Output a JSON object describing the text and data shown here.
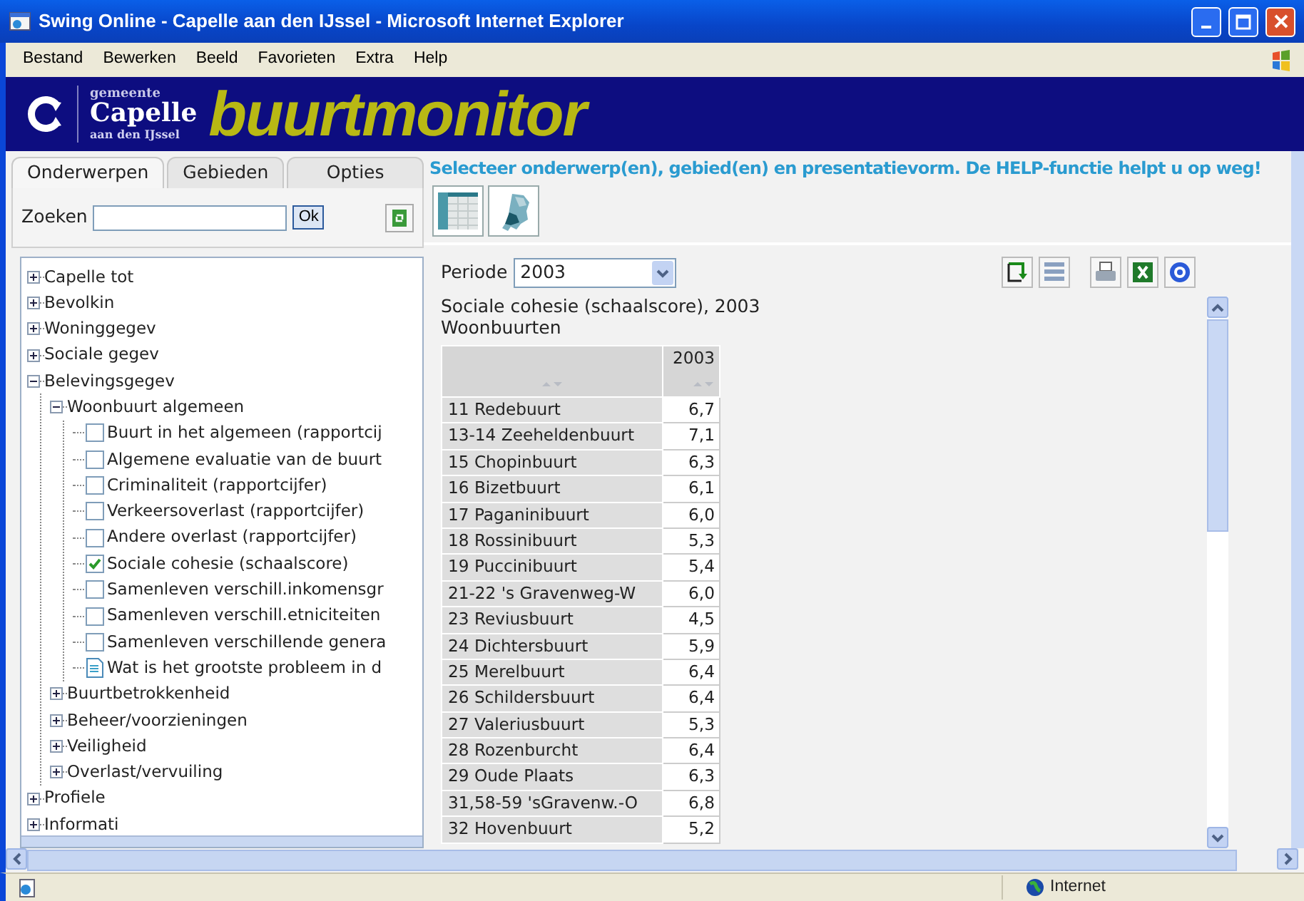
{
  "window": {
    "title": "Swing Online - Capelle aan den IJssel - Microsoft Internet Explorer"
  },
  "menu": [
    "Bestand",
    "Bewerken",
    "Beeld",
    "Favorieten",
    "Extra",
    "Help"
  ],
  "logo": {
    "top": "gemeente",
    "name": "Capelle",
    "sub": "aan den IJssel",
    "product": "buurtmonitor"
  },
  "tabs": [
    {
      "label": "Onderwerpen",
      "selected": true
    },
    {
      "label": "Gebieden",
      "selected": false
    },
    {
      "label": "Opties",
      "selected": false
    }
  ],
  "search": {
    "label": "Zoeken",
    "button": "Ok"
  },
  "tree": [
    {
      "label": "Capelle tot",
      "kind": "folder",
      "expanded": false
    },
    {
      "label": "Bevolkin",
      "kind": "folder",
      "expanded": false
    },
    {
      "label": "Woninggegev",
      "kind": "folder",
      "expanded": false
    },
    {
      "label": "Sociale gegev",
      "kind": "folder",
      "expanded": false
    },
    {
      "label": "Belevingsgegev",
      "kind": "folder",
      "expanded": true,
      "children": [
        {
          "label": "Woonbuurt algemeen",
          "kind": "folder",
          "expanded": true,
          "children": [
            {
              "label": "Buurt in het algemeen (rapportcij",
              "kind": "checkbox",
              "checked": false
            },
            {
              "label": "Algemene evaluatie van de buurt",
              "kind": "checkbox",
              "checked": false
            },
            {
              "label": "Criminaliteit (rapportcijfer)",
              "kind": "checkbox",
              "checked": false
            },
            {
              "label": "Verkeersoverlast (rapportcijfer)",
              "kind": "checkbox",
              "checked": false
            },
            {
              "label": "Andere overlast (rapportcijfer)",
              "kind": "checkbox",
              "checked": false
            },
            {
              "label": "Sociale cohesie (schaalscore)",
              "kind": "checkbox",
              "checked": true
            },
            {
              "label": "Samenleven verschill.inkomensgr",
              "kind": "checkbox",
              "checked": false
            },
            {
              "label": "Samenleven verschill.etniciteiten",
              "kind": "checkbox",
              "checked": false
            },
            {
              "label": "Samenleven verschillende genera",
              "kind": "checkbox",
              "checked": false
            },
            {
              "label": "Wat is het grootste probleem in d",
              "kind": "document"
            }
          ]
        },
        {
          "label": "Buurtbetrokkenheid",
          "kind": "folder",
          "expanded": false
        },
        {
          "label": "Beheer/voorzieningen",
          "kind": "folder",
          "expanded": false
        },
        {
          "label": "Veiligheid",
          "kind": "folder",
          "expanded": false
        },
        {
          "label": "Overlast/vervuiling",
          "kind": "folder",
          "expanded": false
        }
      ]
    },
    {
      "label": "Profiele",
      "kind": "folder",
      "expanded": false
    },
    {
      "label": "Informati",
      "kind": "folder",
      "expanded": false
    }
  ],
  "instruction": "Selecteer onderwerp(en), gebied(en) en presentatievorm. De HELP-functie helpt u op weg!",
  "period": {
    "label": "Periode",
    "value": "2003"
  },
  "table_title": "Sociale cohesie (schaalscore), 2003",
  "table_subtitle": "Woonbuurten",
  "table": {
    "columns": [
      {
        "label": "2003"
      }
    ],
    "rows": [
      {
        "name": "11 Redebuurt",
        "value": "6,7"
      },
      {
        "name": "13-14 Zeeheldenbuurt",
        "value": "7,1"
      },
      {
        "name": "15 Chopinbuurt",
        "value": "6,3"
      },
      {
        "name": "16 Bizetbuurt",
        "value": "6,1"
      },
      {
        "name": "17 Paganinibuurt",
        "value": "6,0"
      },
      {
        "name": "18 Rossinibuurt",
        "value": "5,3"
      },
      {
        "name": "19 Puccinibuurt",
        "value": "5,4"
      },
      {
        "name": "21-22 's Gravenweg-W",
        "value": "6,0"
      },
      {
        "name": "23 Reviusbuurt",
        "value": "4,5"
      },
      {
        "name": "24 Dichtersbuurt",
        "value": "5,9"
      },
      {
        "name": "25 Merelbuurt",
        "value": "6,4"
      },
      {
        "name": "26 Schildersbuurt",
        "value": "6,4"
      },
      {
        "name": "27 Valeriusbuurt",
        "value": "5,3"
      },
      {
        "name": "28 Rozenburcht",
        "value": "6,4"
      },
      {
        "name": "29 Oude Plaats",
        "value": "6,3"
      },
      {
        "name": "31,58-59 'sGravenw.-O",
        "value": "6,8"
      },
      {
        "name": "32 Hovenbuurt",
        "value": "5,2"
      }
    ]
  },
  "status_bar": {
    "zone": "Internet"
  }
}
